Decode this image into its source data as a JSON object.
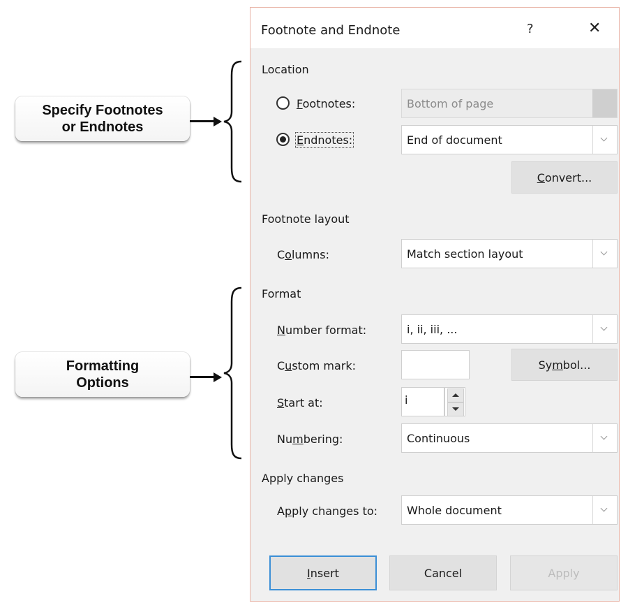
{
  "callouts": {
    "location": {
      "line1": "Specify Footnotes",
      "line2": "or Endnotes"
    },
    "format": {
      "line1": "Formatting",
      "line2": "Options"
    }
  },
  "dialog": {
    "title": "Footnote and Endnote",
    "help": "?",
    "close": "✕",
    "location": {
      "heading": "Location",
      "footnotes": {
        "label_pre": "",
        "label_u": "F",
        "label_post": "ootnotes:",
        "value": "Bottom of page",
        "checked": false
      },
      "endnotes": {
        "label_pre": "",
        "label_u": "E",
        "label_post": "ndnotes:",
        "value": "End of document",
        "checked": true
      },
      "convert": {
        "pre": "",
        "u": "C",
        "post": "onvert..."
      }
    },
    "footnote_layout": {
      "heading": "Footnote layout",
      "columns": {
        "label_pre": "C",
        "label_u": "o",
        "label_post": "lumns:",
        "value": "Match section layout"
      }
    },
    "format": {
      "heading": "Format",
      "number_format": {
        "label_pre": "",
        "label_u": "N",
        "label_post": "umber format:",
        "value": "i, ii, iii, ..."
      },
      "custom_mark": {
        "label_pre": "C",
        "label_u": "u",
        "label_post": "stom mark:",
        "value": ""
      },
      "symbol": {
        "pre": "Sy",
        "u": "m",
        "post": "bol..."
      },
      "start_at": {
        "label_pre": "",
        "label_u": "S",
        "label_post": "tart at:",
        "value": "i"
      },
      "numbering": {
        "label_pre": "Nu",
        "label_u": "m",
        "label_post": "bering:",
        "value": "Continuous"
      }
    },
    "apply_changes": {
      "heading": "Apply changes",
      "apply_to": {
        "label_pre": "A",
        "label_u": "p",
        "label_post": "ply changes to:",
        "value": "Whole document"
      }
    },
    "buttons": {
      "insert": {
        "pre": "",
        "u": "I",
        "post": "nsert"
      },
      "cancel": "Cancel",
      "apply": "Apply"
    }
  }
}
